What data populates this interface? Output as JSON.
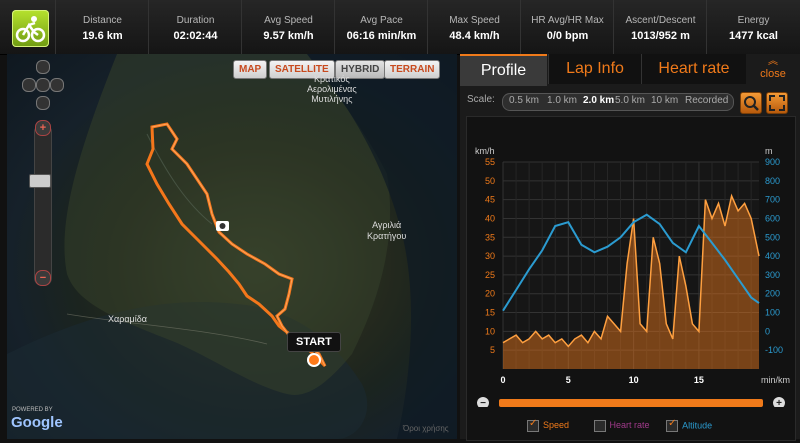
{
  "stats": [
    {
      "label": "Distance",
      "value": "19.6 km"
    },
    {
      "label": "Duration",
      "value": "02:02:44"
    },
    {
      "label": "Avg Speed",
      "value": "9.57 km/h"
    },
    {
      "label": "Avg Pace",
      "value": "06:16 min/km"
    },
    {
      "label": "Max Speed",
      "value": "48.4 km/h"
    },
    {
      "label": "HR Avg/HR Max",
      "value": "0/0 bpm"
    },
    {
      "label": "Ascent/Descent",
      "value": "1013/952 m"
    },
    {
      "label": "Energy",
      "value": "1477 kcal"
    }
  ],
  "map": {
    "buttons": [
      "MAP",
      "SATELLITE",
      "HYBRID",
      "TERRAIN"
    ],
    "active": "HYBRID",
    "labels": [
      {
        "text": "Κρατικός\nΑερολιμένας\nΜυτιλήνης"
      },
      {
        "text": "Αγριλιά\nΚρατήγου"
      },
      {
        "text": "Χαραμίδα"
      }
    ],
    "start_label": "START",
    "powered_by": "POWERED BY",
    "google": "Google",
    "terms": "Όροι χρήσης"
  },
  "panel": {
    "tabs": [
      "Profile",
      "Lap Info",
      "Heart rate"
    ],
    "close": "close",
    "scale_label": "Scale:",
    "scale_options": [
      "0.5 km",
      "1.0 km",
      "2.0 km",
      "5.0 km",
      "10 km",
      "Recorded"
    ],
    "scale_active": "2.0 km",
    "legend": {
      "speed": "Speed",
      "heart": "Heart rate",
      "altitude": "Altitude"
    },
    "colors": {
      "accent": "#f07a1a",
      "altitude": "#2b9bd0",
      "grid": "#333333"
    }
  },
  "chart_data": {
    "type": "line",
    "x_label": "min/km",
    "left_unit": "km/h",
    "right_unit": "m",
    "x_ticks": [
      0,
      5,
      10,
      15
    ],
    "xlim": [
      0,
      19.6
    ],
    "speed_ylim": [
      0,
      55
    ],
    "alt_ylim": [
      -200,
      900
    ],
    "speed_ticks": [
      5,
      10,
      15,
      20,
      25,
      30,
      35,
      40,
      45,
      50,
      55
    ],
    "alt_ticks": [
      -100,
      0,
      100,
      200,
      300,
      400,
      500,
      600,
      700,
      800,
      900
    ],
    "series": [
      {
        "name": "Speed",
        "x": [
          0,
          0.5,
          1,
          1.5,
          2,
          2.5,
          3,
          3.5,
          4,
          4.5,
          5,
          5.5,
          6,
          6.5,
          7,
          7.5,
          8,
          8.5,
          9,
          9.5,
          10,
          10.5,
          11,
          11.5,
          12,
          12.5,
          13,
          13.5,
          14,
          14.5,
          15,
          15.5,
          16,
          16.5,
          17,
          17.5,
          18,
          18.5,
          19,
          19.6
        ],
        "values": [
          7,
          8,
          9,
          7,
          8,
          10,
          8,
          9,
          7,
          8,
          6,
          8,
          9,
          7,
          10,
          8,
          14,
          12,
          10,
          28,
          40,
          12,
          10,
          35,
          28,
          12,
          8,
          30,
          22,
          12,
          10,
          45,
          40,
          44,
          38,
          46,
          42,
          44,
          40,
          30
        ]
      },
      {
        "name": "Altitude",
        "x": [
          0,
          1,
          2,
          3,
          4,
          5,
          6,
          7,
          8,
          9,
          10,
          11,
          12,
          13,
          14,
          15,
          16,
          17,
          18,
          19,
          19.6
        ],
        "values": [
          110,
          220,
          330,
          430,
          560,
          580,
          460,
          420,
          450,
          500,
          580,
          620,
          570,
          470,
          420,
          560,
          470,
          380,
          280,
          180,
          150
        ]
      }
    ]
  }
}
